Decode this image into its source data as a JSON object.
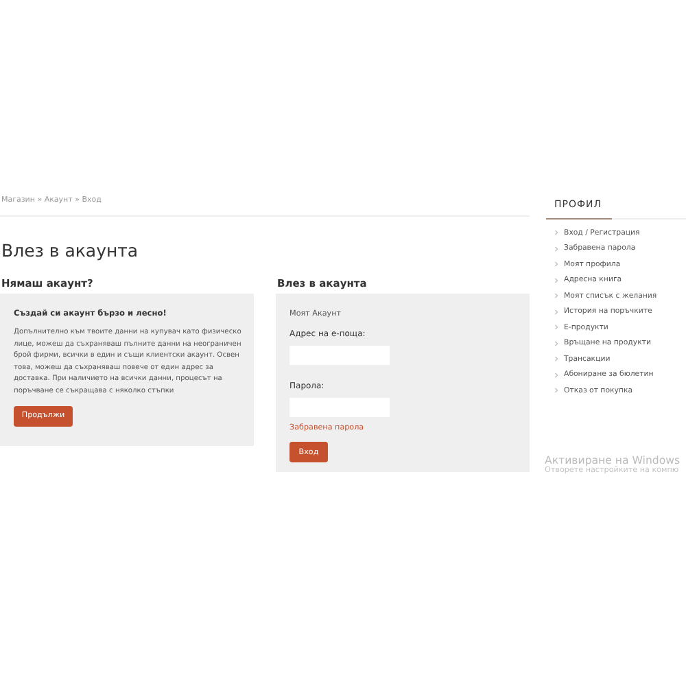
{
  "breadcrumb": "Магазин » Акаунт » Вход",
  "page_title": "Влез в акаунта",
  "register": {
    "heading": "Нямаш акаунт?",
    "title": "Създай си акаунт бързо и лесно!",
    "text": "Допълнително към твоите данни на купувач като физическо лице, можеш да съхраняваш пълните данни на неограничен брой фирми, всички в един и същи клиентски акаунт. Освен това, можеш да съхраняваш повече от един адрес за доставка. При наличието на всички данни, процесът на поръчване се съкращава с няколко стъпки",
    "button": "Продължи"
  },
  "login": {
    "heading": "Влез в акаунта",
    "subtitle": "Моят Акаунт",
    "email_label": "Адрес на е-поща:",
    "password_label": "Парола:",
    "forgot_link": "Забравена парола",
    "button": "Вход"
  },
  "sidebar": {
    "title": "ПРОФИЛ",
    "items": [
      {
        "label": "Вход / Регистрация"
      },
      {
        "label": "Забравена парола"
      },
      {
        "label": "Моят профила"
      },
      {
        "label": "Адресна книга"
      },
      {
        "label": "Моят списък с желания"
      },
      {
        "label": "История на поръчките"
      },
      {
        "label": "Е-продукти"
      },
      {
        "label": "Връщане на продукти"
      },
      {
        "label": "Трансакции"
      },
      {
        "label": "Абониране за бюлетин"
      },
      {
        "label": "Отказ от покупка"
      }
    ]
  },
  "windows_notice": {
    "title": "Активиране на Windows",
    "text": "Отворете настройките на компю"
  }
}
